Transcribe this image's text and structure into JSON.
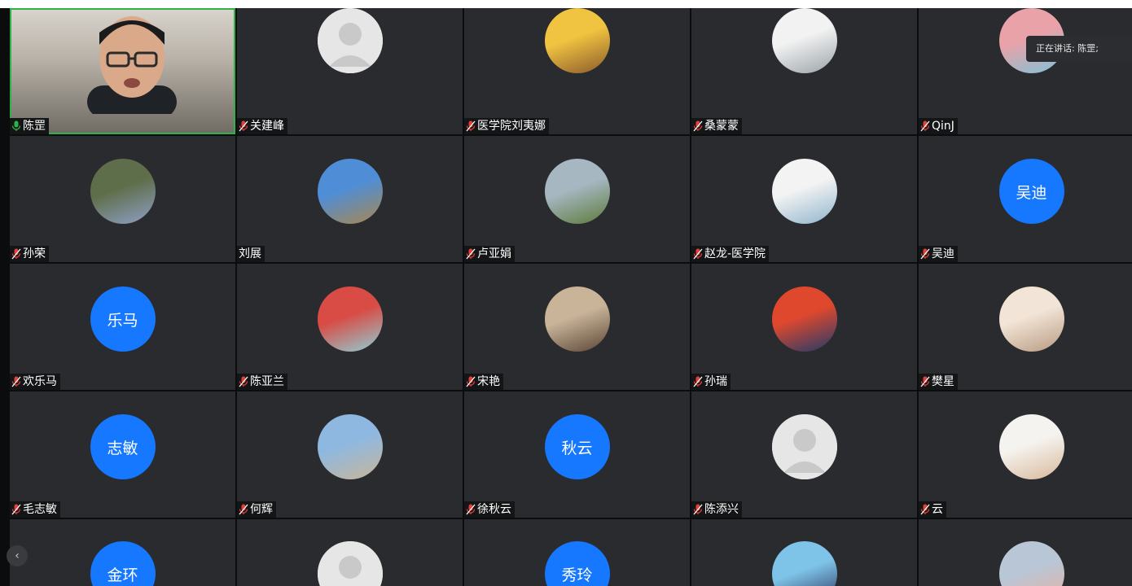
{
  "speaking": {
    "text": "正在讲话: 陈罡;"
  },
  "nav": {
    "prev_icon": "chevron-left-icon",
    "prev_glyph": "‹"
  },
  "colors": {
    "tile_bg": "#2a2b2e",
    "initials_bg": "#1677ff",
    "active_border": "#2fb24a",
    "mic_unmuted": "#2fb24a",
    "mic_muted": "#e0403a"
  },
  "participants": [
    {
      "name": "陈罡",
      "avatar": "video",
      "mic": "on",
      "active": true
    },
    {
      "name": "关建峰",
      "avatar": "placeholder",
      "mic": "muted"
    },
    {
      "name": "医学院刘夷娜",
      "avatar": "photo",
      "photo_colors": [
        "#f0c340",
        "#8a5a2b"
      ],
      "mic": "muted"
    },
    {
      "name": "桑蒙蒙",
      "avatar": "photo",
      "photo_colors": [
        "#f2f2f2",
        "#9aa3a8"
      ],
      "mic": "muted"
    },
    {
      "name": "QinJ",
      "avatar": "photo",
      "photo_colors": [
        "#e9a2a8",
        "#7fc2d9"
      ],
      "mic": "muted"
    },
    {
      "name": "孙荣",
      "avatar": "photo",
      "photo_colors": [
        "#5f6e4a",
        "#8fa0c8"
      ],
      "mic": "muted"
    },
    {
      "name": "刘展",
      "avatar": "photo",
      "photo_colors": [
        "#4f8ed6",
        "#a8874f"
      ],
      "mic": "none"
    },
    {
      "name": "卢亚娟",
      "avatar": "photo",
      "photo_colors": [
        "#a6b7c2",
        "#5c7a3a"
      ],
      "mic": "muted"
    },
    {
      "name": "赵龙-医学院",
      "avatar": "photo",
      "photo_colors": [
        "#f3f3f3",
        "#8fb4cc"
      ],
      "mic": "muted"
    },
    {
      "name": "吴迪",
      "avatar": "initials",
      "initials": "吴迪",
      "mic": "muted"
    },
    {
      "name": "欢乐马",
      "avatar": "initials",
      "initials": "乐马",
      "mic": "muted"
    },
    {
      "name": "陈亚兰",
      "avatar": "photo",
      "photo_colors": [
        "#d84c45",
        "#8fd0d6"
      ],
      "mic": "muted"
    },
    {
      "name": "宋艳",
      "avatar": "photo",
      "photo_colors": [
        "#c9b49a",
        "#5a4534"
      ],
      "mic": "muted"
    },
    {
      "name": "孙瑞",
      "avatar": "photo",
      "photo_colors": [
        "#e0482e",
        "#1f3a6a"
      ],
      "mic": "muted"
    },
    {
      "name": "樊星",
      "avatar": "photo",
      "photo_colors": [
        "#f2e4d6",
        "#b89a82"
      ],
      "mic": "muted"
    },
    {
      "name": "毛志敏",
      "avatar": "initials",
      "initials": "志敏",
      "mic": "muted"
    },
    {
      "name": "何辉",
      "avatar": "photo",
      "photo_colors": [
        "#8fb8e0",
        "#c7b69a"
      ],
      "mic": "muted"
    },
    {
      "name": "徐秋云",
      "avatar": "initials",
      "initials": "秋云",
      "mic": "muted"
    },
    {
      "name": "陈添兴",
      "avatar": "placeholder",
      "mic": "muted"
    },
    {
      "name": "云",
      "avatar": "photo",
      "photo_colors": [
        "#f5f3ef",
        "#d8b89a"
      ],
      "mic": "muted"
    },
    {
      "name": "",
      "avatar": "initials",
      "initials": "金环",
      "mic": "none"
    },
    {
      "name": "",
      "avatar": "placeholder",
      "mic": "none"
    },
    {
      "name": "",
      "avatar": "initials",
      "initials": "秀玲",
      "mic": "none"
    },
    {
      "name": "",
      "avatar": "photo",
      "photo_colors": [
        "#7ec4e8",
        "#2b2f5a"
      ],
      "mic": "none"
    },
    {
      "name": "",
      "avatar": "photo",
      "photo_colors": [
        "#b9c6d6",
        "#e8b0a0"
      ],
      "mic": "none"
    }
  ]
}
